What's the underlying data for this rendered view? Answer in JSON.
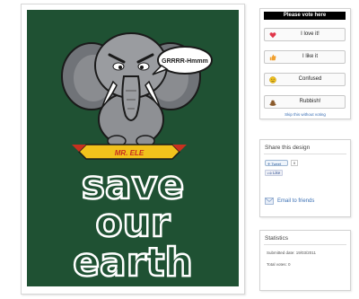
{
  "artwork": {
    "speech_text": "GRRRR-Hmmm",
    "banner_text": "MR. ELE",
    "headline": [
      "save",
      "our",
      "earth"
    ]
  },
  "vote": {
    "header": "Please vote here",
    "options": [
      {
        "label": "I love it!",
        "icon": "heart-icon",
        "color": "#e0364a"
      },
      {
        "label": "I like it",
        "icon": "thumbs-up-icon",
        "color": "#f0a030"
      },
      {
        "label": "Confused",
        "icon": "confused-face-icon",
        "color": "#f2c21c"
      },
      {
        "label": "Rubbish!",
        "icon": "poop-icon",
        "color": "#8a5a2b"
      }
    ],
    "skip_label": "Skip this without voting"
  },
  "share": {
    "title": "Share this design",
    "tweet_label": "Tweet",
    "tweet_count": "0",
    "like_label": "Like",
    "email_label": "Email to friends"
  },
  "stats": {
    "title": "Statistics",
    "submitted": "Submitted date: 19/03/2011",
    "total_votes": "Total votes: 0"
  },
  "colors": {
    "artwork_background": "#1f5133",
    "elephant": "#8e9094",
    "banner": "#f2c21c",
    "link": "#3a6fb4"
  }
}
